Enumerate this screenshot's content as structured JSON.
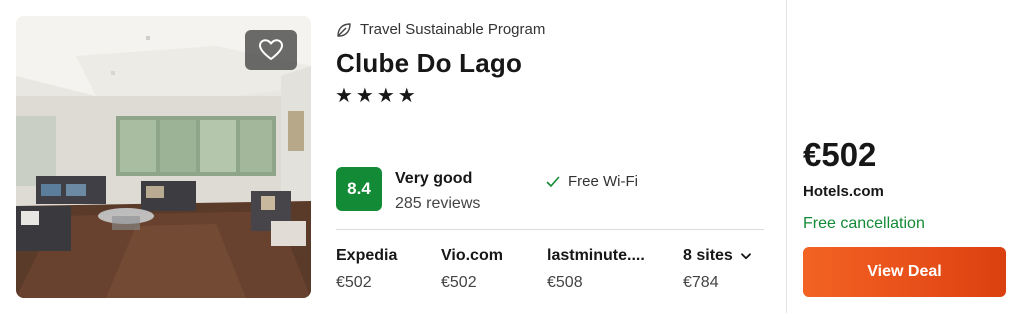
{
  "hotel": {
    "sustainability_label": "Travel Sustainable Program",
    "name": "Clube Do Lago",
    "stars": "★★★★",
    "star_count": 4,
    "rating": {
      "score": "8.4",
      "label": "Very good",
      "reviews": "285 reviews",
      "score_color": "#138a36"
    },
    "amenity": "Free Wi-Fi"
  },
  "alternatives": [
    {
      "provider": "Expedia",
      "price": "€502"
    },
    {
      "provider": "Vio.com",
      "price": "€502"
    },
    {
      "provider": "lastminute....",
      "price": "€508"
    }
  ],
  "more_sites": {
    "label": "8 sites",
    "price": "€784"
  },
  "deal": {
    "price": "€502",
    "provider": "Hotels.com",
    "cancellation": "Free cancellation",
    "button_label": "View Deal",
    "button_color": "#e8501a"
  },
  "icons": {
    "favorite": "heart-outline-icon",
    "sustainability": "leaf-icon",
    "amenity": "checkmark-icon",
    "more_sites": "chevron-down-icon"
  }
}
